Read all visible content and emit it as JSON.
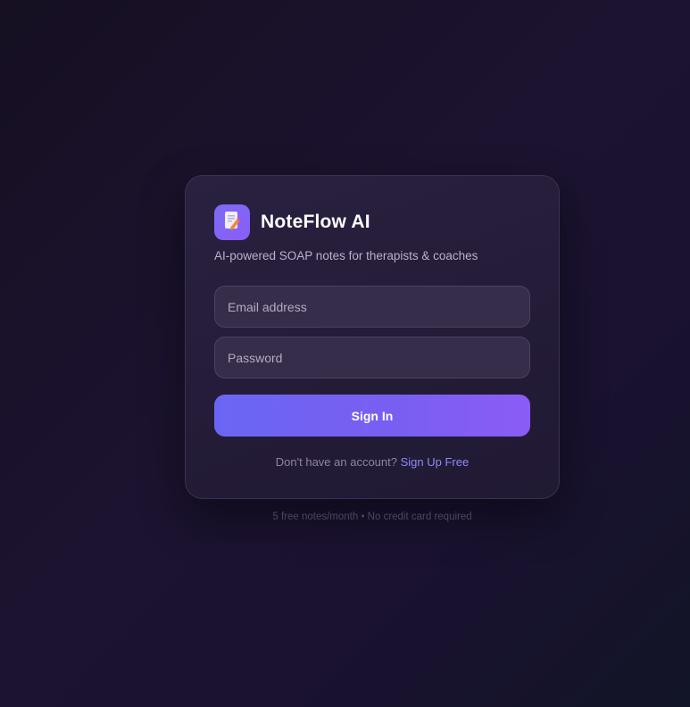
{
  "app": {
    "title": "NoteFlow AI",
    "subtitle": "AI-powered SOAP notes for therapists & coaches",
    "logo_icon": "notepad-pencil-icon"
  },
  "form": {
    "email_placeholder": "Email address",
    "email_value": "",
    "password_placeholder": "Password",
    "password_value": "",
    "submit_label": "Sign In"
  },
  "signup": {
    "prompt": "Don't have an account?",
    "link_label": "Sign Up Free"
  },
  "footer": {
    "note": "5 free notes/month • No credit card required"
  },
  "colors": {
    "accent_start": "#6a66f3",
    "accent_end": "#8b5cf6",
    "link": "#8b8cf8",
    "background": "#1a1230"
  }
}
